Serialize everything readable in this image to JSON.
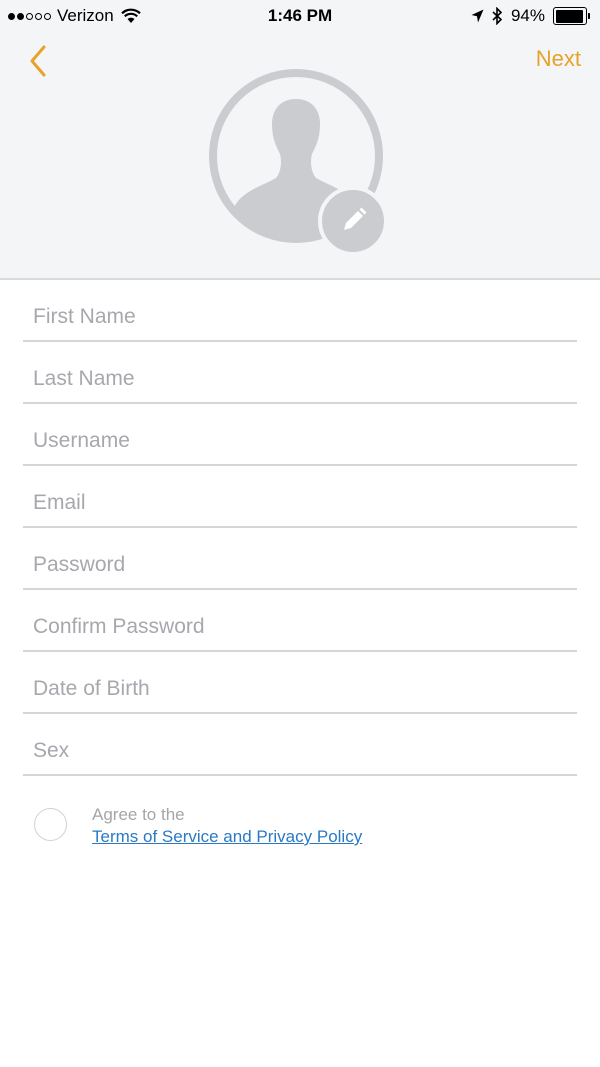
{
  "status_bar": {
    "carrier": "Verizon",
    "time": "1:46 PM",
    "battery": "94%",
    "battery_level": 0.94,
    "signal_dots_filled": 2,
    "signal_dots_total": 5
  },
  "header": {
    "back_icon": "chevron-left-icon",
    "next_label": "Next",
    "avatar_icon": "user-silhouette-icon",
    "edit_icon": "pencil-icon",
    "accent_color": "#e8a22a"
  },
  "form": {
    "fields": [
      {
        "name": "first-name-field",
        "placeholder": "First Name",
        "value": ""
      },
      {
        "name": "last-name-field",
        "placeholder": "Last Name",
        "value": ""
      },
      {
        "name": "username-field",
        "placeholder": "Username",
        "value": ""
      },
      {
        "name": "email-field",
        "placeholder": "Email",
        "value": ""
      },
      {
        "name": "password-field",
        "placeholder": "Password",
        "value": ""
      },
      {
        "name": "confirm-password-field",
        "placeholder": "Confirm Password",
        "value": ""
      },
      {
        "name": "date-of-birth-field",
        "placeholder": "Date of Birth",
        "value": ""
      },
      {
        "name": "sex-field",
        "placeholder": "Sex",
        "value": ""
      }
    ]
  },
  "agreement": {
    "label": "Agree to the",
    "link_text": "Terms of Service and Privacy Policy",
    "checked": false,
    "link_color": "#2a79c4"
  }
}
